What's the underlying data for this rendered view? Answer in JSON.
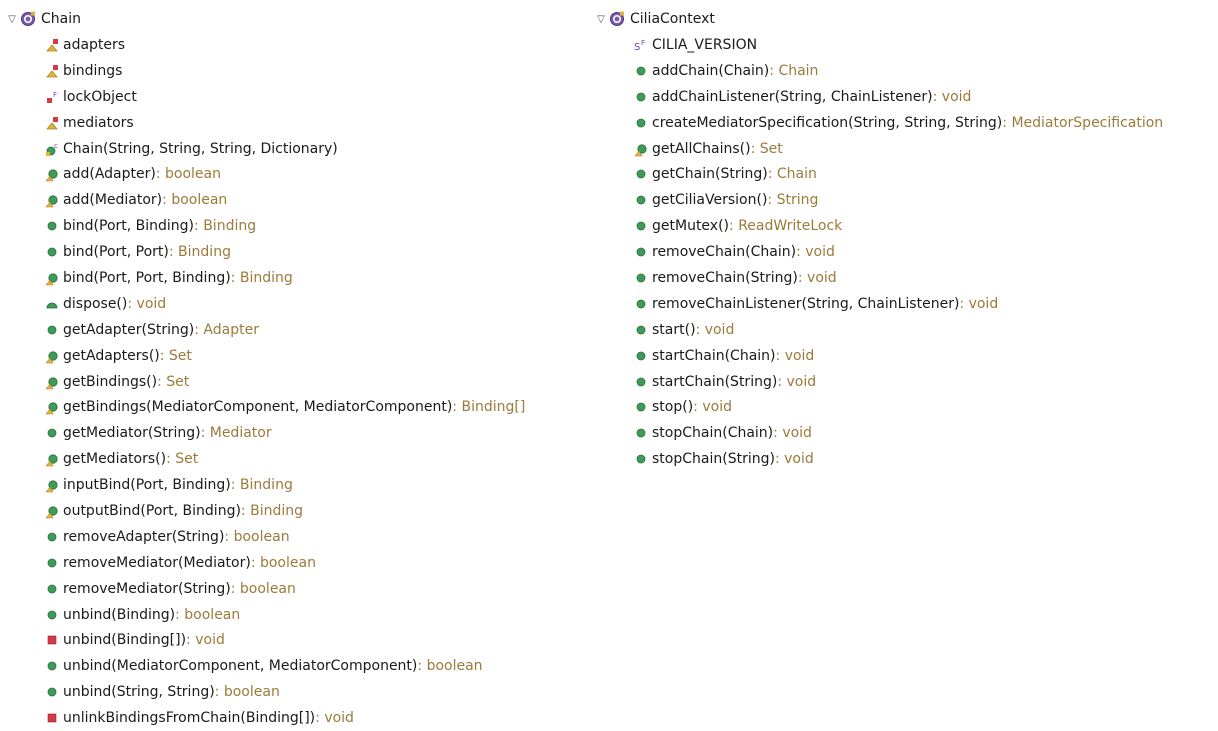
{
  "colors": {
    "public": "#3f9b58",
    "private": "#d23a44",
    "protected": "#e3b33b",
    "default": "#5b88c7",
    "return_type": "#9c7a3a",
    "static_marker": "#7b3f9e"
  },
  "trees": [
    {
      "name": "Chain",
      "icon": "interface-icon",
      "expanded_glyph": "▽",
      "members": [
        {
          "name": "adapters",
          "type": "",
          "icon": "field-protected-icon"
        },
        {
          "name": "bindings",
          "type": "",
          "icon": "field-protected-icon"
        },
        {
          "name": "lockObject",
          "type": "",
          "icon": "field-final-icon"
        },
        {
          "name": "mediators",
          "type": "",
          "icon": "field-protected-icon"
        },
        {
          "name": "Chain(String, String, String, Dictionary)",
          "type": "",
          "icon": "constructor-icon"
        },
        {
          "name": "add(Adapter)",
          "type": "boolean",
          "icon": "method-synchronized-icon"
        },
        {
          "name": "add(Mediator)",
          "type": "boolean",
          "icon": "method-synchronized-icon"
        },
        {
          "name": "bind(Port, Binding)",
          "type": "Binding",
          "icon": "method-public-icon"
        },
        {
          "name": "bind(Port, Port)",
          "type": "Binding",
          "icon": "method-public-icon"
        },
        {
          "name": "bind(Port, Port, Binding)",
          "type": "Binding",
          "icon": "method-synchronized-icon"
        },
        {
          "name": "dispose()",
          "type": "void",
          "icon": "method-dispose-icon"
        },
        {
          "name": "getAdapter(String)",
          "type": "Adapter",
          "icon": "method-public-icon"
        },
        {
          "name": "getAdapters()",
          "type": "Set",
          "icon": "method-synchronized-icon"
        },
        {
          "name": "getBindings()",
          "type": "Set",
          "icon": "method-synchronized-icon"
        },
        {
          "name": "getBindings(MediatorComponent, MediatorComponent)",
          "type": "Binding[]",
          "icon": "method-synchronized-icon"
        },
        {
          "name": "getMediator(String)",
          "type": "Mediator",
          "icon": "method-public-icon"
        },
        {
          "name": "getMediators()",
          "type": "Set",
          "icon": "method-synchronized-icon"
        },
        {
          "name": "inputBind(Port, Binding)",
          "type": "Binding",
          "icon": "method-synchronized-icon"
        },
        {
          "name": "outputBind(Port, Binding)",
          "type": "Binding",
          "icon": "method-synchronized-icon"
        },
        {
          "name": "removeAdapter(String)",
          "type": "boolean",
          "icon": "method-public-icon"
        },
        {
          "name": "removeMediator(Mediator)",
          "type": "boolean",
          "icon": "method-public-icon"
        },
        {
          "name": "removeMediator(String)",
          "type": "boolean",
          "icon": "method-public-icon"
        },
        {
          "name": "unbind(Binding)",
          "type": "boolean",
          "icon": "method-public-icon"
        },
        {
          "name": "unbind(Binding[])",
          "type": "void",
          "icon": "method-private-icon"
        },
        {
          "name": "unbind(MediatorComponent, MediatorComponent)",
          "type": "boolean",
          "icon": "method-public-icon"
        },
        {
          "name": "unbind(String, String)",
          "type": "boolean",
          "icon": "method-public-icon"
        },
        {
          "name": "unlinkBindingsFromChain(Binding[])",
          "type": "void",
          "icon": "method-private-icon"
        }
      ]
    },
    {
      "name": "CiliaContext",
      "icon": "interface-icon",
      "expanded_glyph": "▽",
      "members": [
        {
          "name": "CILIA_VERSION",
          "type": "",
          "icon": "field-static-final-icon"
        },
        {
          "name": "addChain(Chain)",
          "type": "Chain",
          "icon": "method-public-icon"
        },
        {
          "name": "addChainListener(String, ChainListener)",
          "type": "void",
          "icon": "method-public-icon"
        },
        {
          "name": "createMediatorSpecification(String, String, String)",
          "type": "MediatorSpecification",
          "icon": "method-public-icon"
        },
        {
          "name": "getAllChains()",
          "type": "Set",
          "icon": "method-synchronized-icon"
        },
        {
          "name": "getChain(String)",
          "type": "Chain",
          "icon": "method-public-icon"
        },
        {
          "name": "getCiliaVersion()",
          "type": "String",
          "icon": "method-public-icon"
        },
        {
          "name": "getMutex()",
          "type": "ReadWriteLock",
          "icon": "method-public-icon"
        },
        {
          "name": "removeChain(Chain)",
          "type": "void",
          "icon": "method-public-icon"
        },
        {
          "name": "removeChain(String)",
          "type": "void",
          "icon": "method-public-icon"
        },
        {
          "name": "removeChainListener(String, ChainListener)",
          "type": "void",
          "icon": "method-public-icon"
        },
        {
          "name": "start()",
          "type": "void",
          "icon": "method-public-icon"
        },
        {
          "name": "startChain(Chain)",
          "type": "void",
          "icon": "method-public-icon"
        },
        {
          "name": "startChain(String)",
          "type": "void",
          "icon": "method-public-icon"
        },
        {
          "name": "stop()",
          "type": "void",
          "icon": "method-public-icon"
        },
        {
          "name": "stopChain(Chain)",
          "type": "void",
          "icon": "method-public-icon"
        },
        {
          "name": "stopChain(String)",
          "type": "void",
          "icon": "method-public-icon"
        }
      ]
    }
  ]
}
